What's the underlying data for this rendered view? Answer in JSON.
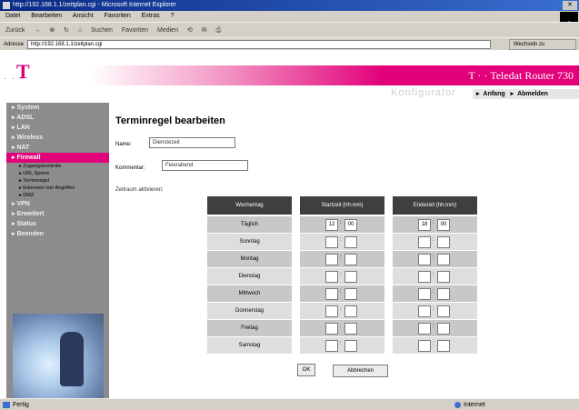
{
  "browser": {
    "title": "http://192.168.1.1/zeitplan.cgi - Microsoft Internet Explorer",
    "menu": [
      "Datei",
      "Bearbeiten",
      "Ansicht",
      "Favoriten",
      "Extras",
      "?"
    ],
    "toolbar": [
      "Zurück",
      "Suchen",
      "Favoriten",
      "Medien"
    ],
    "address_label": "Adresse",
    "address": "http://192.168.1.1/zeitplan.cgi",
    "go_label": "Wechseln zu",
    "status_text": "Fertig",
    "zone_text": "Internet"
  },
  "header": {
    "logo": "T",
    "logo_dots": "· · ·",
    "router_title": "T · · Teledat Router 730",
    "subtitle": "Konfigurator",
    "nav": [
      "Anfang",
      "Abmelden"
    ]
  },
  "sidebar": {
    "items": [
      {
        "label": "System",
        "active": false
      },
      {
        "label": "ADSL",
        "active": false
      },
      {
        "label": "LAN",
        "active": false
      },
      {
        "label": "Wireless",
        "active": false
      },
      {
        "label": "NAT",
        "active": false
      },
      {
        "label": "Firewall",
        "active": true
      },
      {
        "label": "VPN",
        "active": false
      },
      {
        "label": "Erweitert",
        "active": false
      },
      {
        "label": "Status",
        "active": false
      },
      {
        "label": "Beenden",
        "active": false
      }
    ],
    "subitems": [
      "Zugangskontrolle",
      "URL Sperre",
      "Terminregel",
      "Erkennen von Angriffen",
      "DMZ"
    ]
  },
  "main": {
    "title": "Terminregel bearbeiten",
    "name_label": "Name:",
    "name_value": "Dienstezeit",
    "comment_label": "Kommentar:",
    "comment_value": "Feierabend",
    "activate_label": "Zeitraum aktivieren:",
    "columns": [
      "Wochentag",
      "Startzeit (hh:mm)",
      "Endezeit (hh:mm)"
    ],
    "rows": [
      {
        "day": "Täglich",
        "start_h": "12",
        "start_m": "00",
        "end_h": "18",
        "end_m": "00"
      },
      {
        "day": "Sonntag",
        "start_h": "",
        "start_m": "",
        "end_h": "",
        "end_m": ""
      },
      {
        "day": "Montag",
        "start_h": "",
        "start_m": "",
        "end_h": "",
        "end_m": ""
      },
      {
        "day": "Dienstag",
        "start_h": "",
        "start_m": "",
        "end_h": "",
        "end_m": ""
      },
      {
        "day": "Mittwoch",
        "start_h": "",
        "start_m": "",
        "end_h": "",
        "end_m": ""
      },
      {
        "day": "Donnerstag",
        "start_h": "",
        "start_m": "",
        "end_h": "",
        "end_m": ""
      },
      {
        "day": "Freitag",
        "start_h": "",
        "start_m": "",
        "end_h": "",
        "end_m": ""
      },
      {
        "day": "Samstag",
        "start_h": "",
        "start_m": "",
        "end_h": "",
        "end_m": ""
      }
    ],
    "ok_label": "OK",
    "cancel_label": "Abbrechen"
  },
  "colors": {
    "magenta": "#e2007a",
    "sidebar_bg": "#8c8c8c",
    "table_header": "#3f3f3f"
  }
}
